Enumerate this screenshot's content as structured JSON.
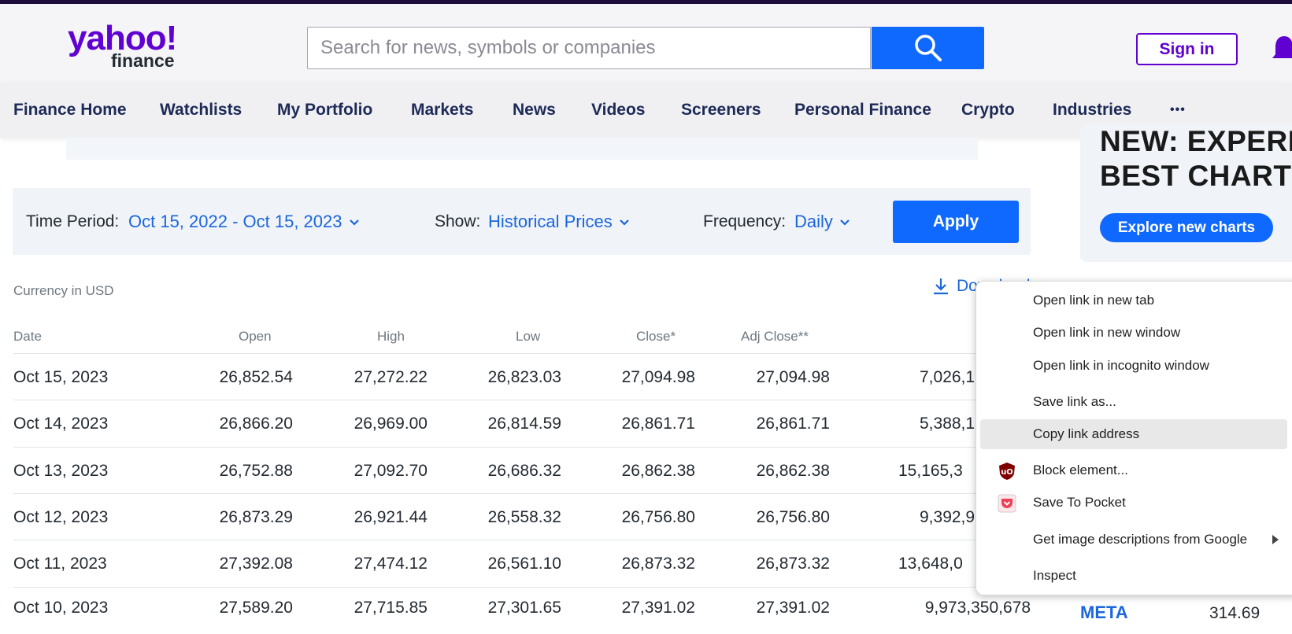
{
  "header": {
    "logo_word": "yahoo!",
    "logo_sub": "finance",
    "search_placeholder": "Search for news, symbols or companies",
    "sign_in": "Sign in"
  },
  "nav": {
    "items": [
      "Finance Home",
      "Watchlists",
      "My Portfolio",
      "Markets",
      "News",
      "Videos",
      "Screeners",
      "Personal Finance",
      "Crypto",
      "Industries",
      "•••"
    ]
  },
  "promo": {
    "title_line1": "NEW: EXPERIE",
    "title_line2": "BEST CHARTS",
    "button": "Explore new charts"
  },
  "filters": {
    "time_period_label": "Time Period:",
    "time_period_value": "Oct 15, 2022 - Oct 15, 2023",
    "show_label": "Show:",
    "show_value": "Historical Prices",
    "frequency_label": "Frequency:",
    "frequency_value": "Daily",
    "apply": "Apply"
  },
  "currency_note": "Currency in USD",
  "download_label": "Download",
  "table": {
    "headers": [
      "Date",
      "Open",
      "High",
      "Low",
      "Close*",
      "Adj Close**"
    ],
    "rows": [
      {
        "date": "Oct 15, 2023",
        "open": "26,852.54",
        "high": "27,272.22",
        "low": "26,823.03",
        "close": "27,094.98",
        "adj": "27,094.98",
        "volume": "7,026,1"
      },
      {
        "date": "Oct 14, 2023",
        "open": "26,866.20",
        "high": "26,969.00",
        "low": "26,814.59",
        "close": "26,861.71",
        "adj": "26,861.71",
        "volume": "5,388,1"
      },
      {
        "date": "Oct 13, 2023",
        "open": "26,752.88",
        "high": "27,092.70",
        "low": "26,686.32",
        "close": "26,862.38",
        "adj": "26,862.38",
        "volume": "15,165,3"
      },
      {
        "date": "Oct 12, 2023",
        "open": "26,873.29",
        "high": "26,921.44",
        "low": "26,558.32",
        "close": "26,756.80",
        "adj": "26,756.80",
        "volume": "9,392,9"
      },
      {
        "date": "Oct 11, 2023",
        "open": "27,392.08",
        "high": "27,474.12",
        "low": "26,561.10",
        "close": "26,873.32",
        "adj": "26,873.32",
        "volume": "13,648,0"
      },
      {
        "date": "Oct 10, 2023",
        "open": "27,589.20",
        "high": "27,715.85",
        "low": "27,301.65",
        "close": "27,391.02",
        "adj": "27,391.02",
        "volume": "9,973,350,678"
      }
    ]
  },
  "sidebar_ticker": {
    "symbol": "META",
    "value": "314.69"
  },
  "context_menu": {
    "items": [
      {
        "label": "Open link in new tab",
        "icon": ""
      },
      {
        "label": "Open link in new window",
        "icon": ""
      },
      {
        "label": "Open link in incognito window",
        "icon": ""
      },
      {
        "label": "Save link as...",
        "icon": ""
      },
      {
        "label": "Copy link address",
        "icon": "",
        "highlighted": true
      },
      {
        "label": "Block element...",
        "icon": "ublock-icon"
      },
      {
        "label": "Save To Pocket",
        "icon": "pocket-icon"
      },
      {
        "label": "Get image descriptions from Google",
        "icon": "",
        "submenu": true
      },
      {
        "label": "Inspect",
        "icon": ""
      }
    ]
  },
  "colors": {
    "brand_purple": "#6001d2",
    "accent_blue": "#0f69ff",
    "link_blue": "#1b66dc",
    "nav_text": "#1d2a56"
  }
}
